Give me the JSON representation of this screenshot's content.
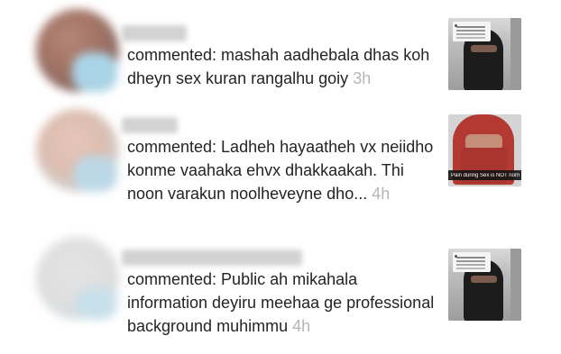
{
  "notifications": [
    {
      "action": "commented: ",
      "comment": "mashah aadhebala dhas koh dheyn sex kuran rangalhu goiy",
      "time": "3h",
      "thumbnail": {
        "type": "video-preview",
        "caption": ""
      }
    },
    {
      "action": "commented: ",
      "comment": "Ladheh hayaatheh vx neiidho konme vaahaka ehvx dhakkaakah. Thi noon varakun noolheveyne dho...",
      "time": "4h",
      "thumbnail": {
        "type": "video-preview",
        "caption": "Pain during Sex is NOT normal"
      }
    },
    {
      "action": "commented: ",
      "comment": "Public ah mikahala information deyiru meehaa ge professional background muhimmu",
      "time": "4h",
      "thumbnail": {
        "type": "video-preview",
        "caption": ""
      }
    }
  ]
}
